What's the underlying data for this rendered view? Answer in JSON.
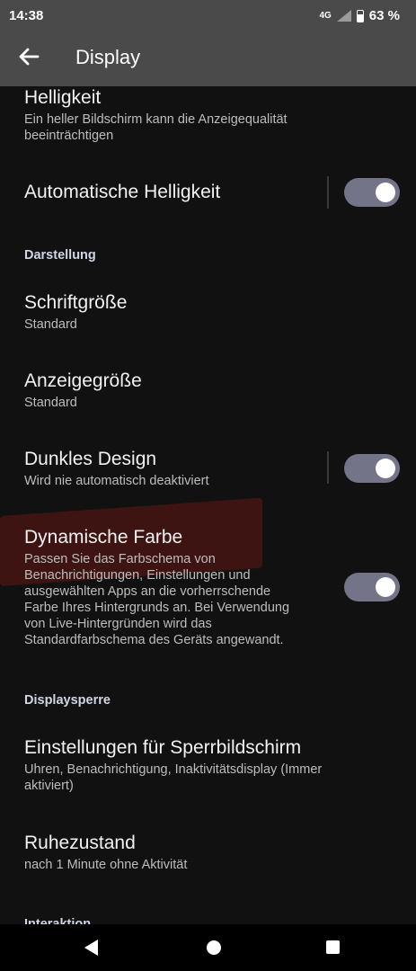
{
  "status": {
    "time": "14:38",
    "network": "4G",
    "battery": "63 %"
  },
  "appbar": {
    "title": "Display",
    "back_icon": "arrow-left-icon"
  },
  "brightness": {
    "title": "Helligkeit",
    "summary_line1": "Ein heller Bildschirm kann die Anzeigequalität",
    "summary_line2": "beeinträchtigen"
  },
  "auto_brightness": {
    "title": "Automatische Helligkeit",
    "enabled": true
  },
  "sections": {
    "appearance": "Darstellung",
    "lockscreen": "Displaysperre",
    "interaction": "Interaktion"
  },
  "font_size": {
    "title": "Schriftgröße",
    "value": "Standard"
  },
  "display_size": {
    "title": "Anzeigegröße",
    "value": "Standard"
  },
  "dark_theme": {
    "title": "Dunkles Design",
    "summary": "Wird nie automatisch deaktiviert",
    "enabled": true
  },
  "dynamic_color": {
    "title": "Dynamische Farbe",
    "summary_lines": [
      "Passen Sie das Farbschema von",
      "Benachrichtigungen, Einstellungen und",
      "ausgewählten Apps an die vorherrschende",
      "Farbe Ihres Hintergrunds an. Bei Verwendung",
      "von Live-Hintergründen wird das",
      "Standardfarbschema des Geräts angewandt."
    ],
    "enabled": true
  },
  "lockscreen_settings": {
    "title": "Einstellungen für Sperrbildschirm",
    "summary_line1": "Uhren, Benachrichtigung, Inaktivitätsdisplay (Immer",
    "summary_line2": "aktiviert)"
  },
  "sleep": {
    "title": "Ruhezustand",
    "summary": "nach 1 Minute ohne Aktivität"
  },
  "colors": {
    "toggle_on": "#747489",
    "appbar": "#4a4a4a",
    "background": "#111111",
    "highlight": "#3e1412"
  }
}
